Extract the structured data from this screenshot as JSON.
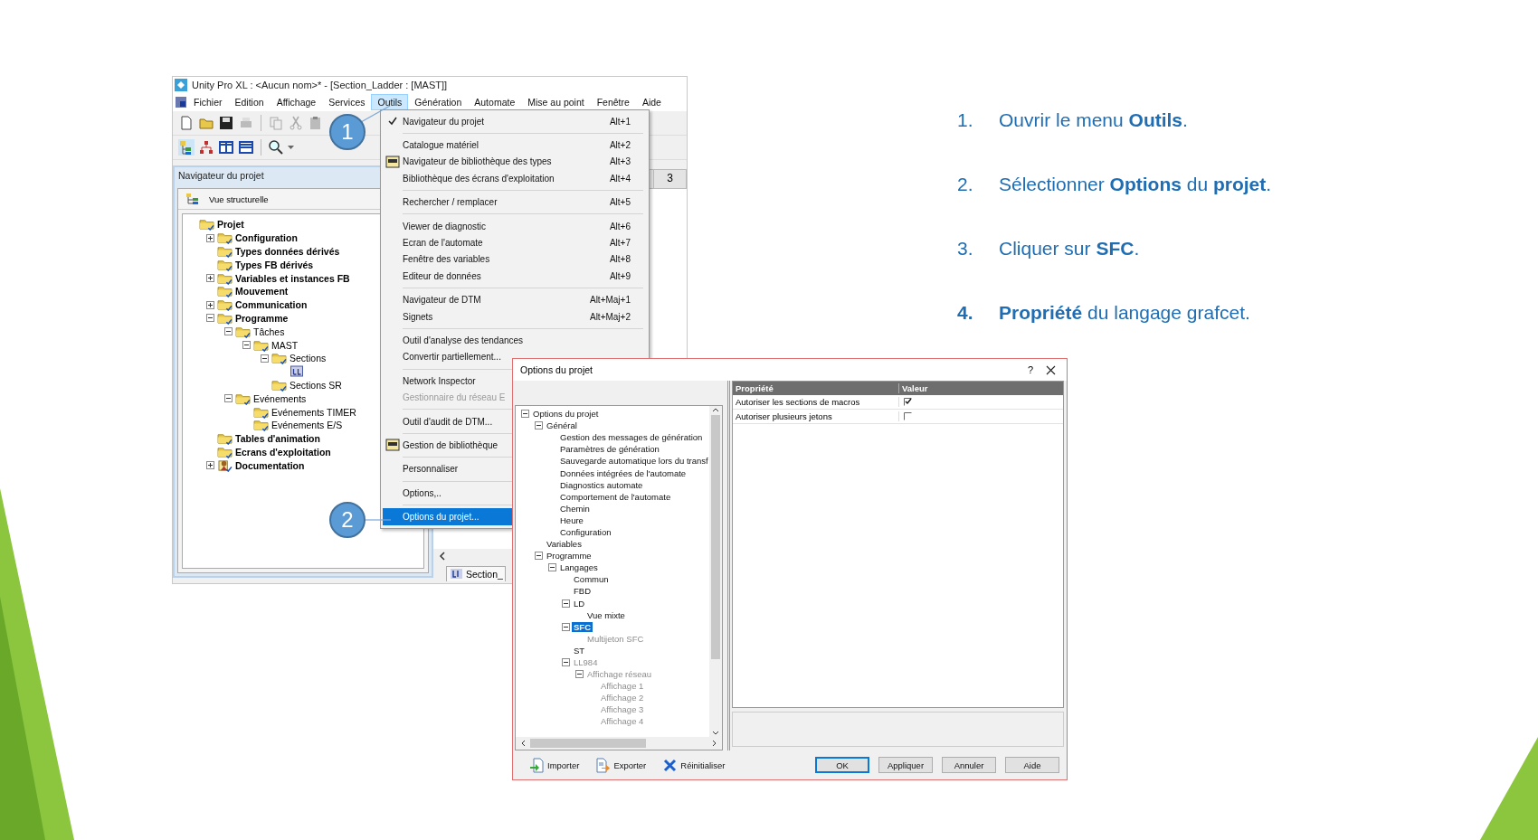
{
  "main_window": {
    "title": "Unity Pro XL : <Aucun nom>* - [Section_Ladder : [MAST]]",
    "menu_bar": [
      {
        "label": "Fichier",
        "selected": false
      },
      {
        "label": "Edition",
        "selected": false
      },
      {
        "label": "Affichage",
        "selected": false
      },
      {
        "label": "Services",
        "selected": false
      },
      {
        "label": "Outils",
        "selected": true
      },
      {
        "label": "Génération",
        "selected": false
      },
      {
        "label": "Automate",
        "selected": false
      },
      {
        "label": "Mise au point",
        "selected": false
      },
      {
        "label": "Fenêtre",
        "selected": false
      },
      {
        "label": "Aide",
        "selected": false
      }
    ],
    "project_browser": {
      "title": "Navigateur du projet",
      "view": "Vue structurelle",
      "tree": [
        {
          "label": "Projet",
          "kind": "folder",
          "children": [
            {
              "label": "Configuration",
              "kind": "folder",
              "expanded": false
            },
            {
              "label": "Types données dérivés",
              "kind": "folder"
            },
            {
              "label": "Types FB dérivés",
              "kind": "folder"
            },
            {
              "label": "Variables et instances FB",
              "kind": "folder",
              "expanded": false
            },
            {
              "label": "Mouvement",
              "kind": "folder"
            },
            {
              "label": "Communication",
              "kind": "folder",
              "expanded": false
            },
            {
              "label": "Programme",
              "kind": "folder",
              "expanded": true,
              "children": [
                {
                  "label": "Tâches",
                  "kind": "folder",
                  "expanded": true,
                  "children": [
                    {
                      "label": "MAST",
                      "kind": "folder",
                      "expanded": true,
                      "children": [
                        {
                          "label": "Sections",
                          "kind": "folder",
                          "expanded": true,
                          "children": [
                            {
                              "kind": "section"
                            }
                          ]
                        },
                        {
                          "label": "Sections SR",
                          "kind": "folder"
                        }
                      ]
                    }
                  ]
                },
                {
                  "label": "Evénements",
                  "kind": "folder",
                  "expanded": true,
                  "children": [
                    {
                      "label": "Evénements TIMER",
                      "kind": "folder"
                    },
                    {
                      "label": "Evénements E/S",
                      "kind": "folder"
                    }
                  ]
                }
              ]
            },
            {
              "label": "Tables d'animation",
              "kind": "folder"
            },
            {
              "label": "Ecrans d'exploitation",
              "kind": "folder"
            },
            {
              "label": "Documentation",
              "kind": "documentation",
              "expanded": false
            }
          ]
        }
      ]
    },
    "editor": {
      "header_cell": "3",
      "tab": "Section_"
    }
  },
  "tools_menu": [
    {
      "kind": "item",
      "label": "Navigateur du projet",
      "shortcut": "Alt+1",
      "checked": true,
      "disabled": false,
      "selected": false,
      "icon": false
    },
    {
      "kind": "separator"
    },
    {
      "kind": "item",
      "label": "Catalogue matériel",
      "shortcut": "Alt+2",
      "checked": false,
      "disabled": false,
      "selected": false,
      "icon": false
    },
    {
      "kind": "item",
      "label": "Navigateur de bibliothèque des types",
      "shortcut": "Alt+3",
      "checked": false,
      "disabled": false,
      "selected": false,
      "icon": true
    },
    {
      "kind": "item",
      "label": "Bibliothèque des écrans d'exploitation",
      "shortcut": "Alt+4",
      "checked": false,
      "disabled": false,
      "selected": false,
      "icon": false
    },
    {
      "kind": "separator"
    },
    {
      "kind": "item",
      "label": "Rechercher / remplacer",
      "shortcut": "Alt+5",
      "checked": false,
      "disabled": false,
      "selected": false,
      "icon": false
    },
    {
      "kind": "separator"
    },
    {
      "kind": "item",
      "label": "Viewer de diagnostic",
      "shortcut": "Alt+6",
      "checked": false,
      "disabled": false,
      "selected": false,
      "icon": false
    },
    {
      "kind": "item",
      "label": "Ecran de l'automate",
      "shortcut": "Alt+7",
      "checked": false,
      "disabled": false,
      "selected": false,
      "icon": false
    },
    {
      "kind": "item",
      "label": "Fenêtre des variables",
      "shortcut": "Alt+8",
      "checked": false,
      "disabled": false,
      "selected": false,
      "icon": false
    },
    {
      "kind": "item",
      "label": "Editeur de données",
      "shortcut": "Alt+9",
      "checked": false,
      "disabled": false,
      "selected": false,
      "icon": false
    },
    {
      "kind": "separator"
    },
    {
      "kind": "item",
      "label": "Navigateur de DTM",
      "shortcut": "Alt+Maj+1",
      "checked": false,
      "disabled": false,
      "selected": false,
      "icon": false
    },
    {
      "kind": "item",
      "label": "Signets",
      "shortcut": "Alt+Maj+2",
      "checked": false,
      "disabled": false,
      "selected": false,
      "icon": false
    },
    {
      "kind": "separator"
    },
    {
      "kind": "item",
      "label": "Outil d'analyse des tendances",
      "checked": false,
      "disabled": false,
      "selected": false,
      "icon": false
    },
    {
      "kind": "item",
      "label": "Convertir partiellement...",
      "checked": false,
      "disabled": false,
      "selected": false,
      "icon": false
    },
    {
      "kind": "separator"
    },
    {
      "kind": "item",
      "label": "Network Inspector",
      "checked": false,
      "disabled": false,
      "selected": false,
      "icon": false
    },
    {
      "kind": "item",
      "label": "Gestionnaire du réseau E",
      "checked": false,
      "disabled": true,
      "selected": false,
      "icon": false
    },
    {
      "kind": "separator"
    },
    {
      "kind": "item",
      "label": "Outil d'audit de DTM...",
      "checked": false,
      "disabled": false,
      "selected": false,
      "icon": false
    },
    {
      "kind": "separator"
    },
    {
      "kind": "item",
      "label": "Gestion de bibliothèque",
      "checked": false,
      "disabled": false,
      "selected": false,
      "icon": true
    },
    {
      "kind": "separator"
    },
    {
      "kind": "item",
      "label": "Personnaliser",
      "checked": false,
      "disabled": false,
      "selected": false,
      "icon": false
    },
    {
      "kind": "separator"
    },
    {
      "kind": "item",
      "label": "Options,..",
      "checked": false,
      "disabled": false,
      "selected": false,
      "icon": false
    },
    {
      "kind": "separator"
    },
    {
      "kind": "item",
      "label": "Options du projet...",
      "checked": false,
      "disabled": false,
      "selected": true,
      "icon": false
    }
  ],
  "options_dialog": {
    "title": "Options du projet",
    "help_button": "?",
    "tree": [
      {
        "label": "Options du projet",
        "expanded": true,
        "selected": false,
        "disabled": false,
        "children": [
          {
            "label": "Général",
            "expanded": true,
            "selected": false,
            "disabled": false,
            "children": [
              {
                "label": "Gestion des messages de génération",
                "selected": false,
                "disabled": false
              },
              {
                "label": "Paramètres de génération",
                "selected": false,
                "disabled": false
              },
              {
                "label": "Sauvegarde automatique lors du transf",
                "selected": false,
                "disabled": false
              },
              {
                "label": "Données intégrées de l'automate",
                "selected": false,
                "disabled": false
              },
              {
                "label": "Diagnostics automate",
                "selected": false,
                "disabled": false
              },
              {
                "label": "Comportement de l'automate",
                "selected": false,
                "disabled": false
              },
              {
                "label": "Chemin",
                "selected": false,
                "disabled": false
              },
              {
                "label": "Heure",
                "selected": false,
                "disabled": false
              },
              {
                "label": "Configuration",
                "selected": false,
                "disabled": false
              }
            ]
          },
          {
            "label": "Variables",
            "selected": false,
            "disabled": false
          },
          {
            "label": "Programme",
            "expanded": true,
            "selected": false,
            "disabled": false,
            "children": [
              {
                "label": "Langages",
                "expanded": true,
                "selected": false,
                "disabled": false,
                "children": [
                  {
                    "label": "Commun",
                    "selected": false,
                    "disabled": false
                  },
                  {
                    "label": "FBD",
                    "selected": false,
                    "disabled": false
                  },
                  {
                    "label": "LD",
                    "expanded": true,
                    "selected": false,
                    "disabled": false,
                    "children": [
                      {
                        "label": "Vue mixte",
                        "selected": false,
                        "disabled": false
                      }
                    ]
                  },
                  {
                    "label": "SFC",
                    "expanded": true,
                    "selected": true,
                    "disabled": false,
                    "children": [
                      {
                        "label": "Multijeton SFC",
                        "selected": false,
                        "disabled": true
                      }
                    ]
                  },
                  {
                    "label": "ST",
                    "selected": false,
                    "disabled": false
                  },
                  {
                    "label": "LL984",
                    "expanded": true,
                    "selected": false,
                    "disabled": true,
                    "children": [
                      {
                        "label": "Affichage réseau",
                        "expanded": true,
                        "selected": false,
                        "disabled": true,
                        "children": [
                          {
                            "label": "Affichage 1",
                            "selected": false,
                            "disabled": true
                          },
                          {
                            "label": "Affichage 2",
                            "selected": false,
                            "disabled": true
                          },
                          {
                            "label": "Affichage 3",
                            "selected": false,
                            "disabled": true
                          },
                          {
                            "label": "Affichage 4",
                            "selected": false,
                            "disabled": true
                          }
                        ]
                      }
                    ]
                  }
                ]
              }
            ]
          }
        ]
      }
    ],
    "grid": {
      "columns": [
        "Propriété",
        "Valeur"
      ],
      "rows": [
        {
          "property": "Autoriser les sections de macros",
          "checked": true
        },
        {
          "property": "Autoriser plusieurs jetons",
          "checked": false
        }
      ]
    },
    "tool_buttons": [
      {
        "label": "Importer",
        "kind": "import"
      },
      {
        "label": "Exporter",
        "kind": "export"
      },
      {
        "label": "Réinitialiser",
        "kind": "reset"
      }
    ],
    "buttons": [
      {
        "label": "OK",
        "focused": true
      },
      {
        "label": "Appliquer",
        "focused": false
      },
      {
        "label": "Annuler",
        "focused": false
      },
      {
        "label": "Aide",
        "focused": false
      }
    ]
  },
  "callouts": [
    {
      "number": "1"
    },
    {
      "number": "2"
    }
  ],
  "steps": [
    {
      "number": "1.",
      "number_bold": false,
      "text": "Ouvrir le menu **Outils**."
    },
    {
      "number": "2.",
      "number_bold": false,
      "text": "Sélectionner **Options** du **projet**."
    },
    {
      "number": "3.",
      "number_bold": false,
      "text": "Cliquer sur **SFC**."
    },
    {
      "number": "4.",
      "number_bold": true,
      "text": "**Propriété** du langage grafcet."
    }
  ]
}
